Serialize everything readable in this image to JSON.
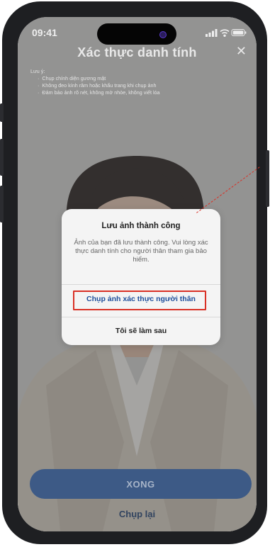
{
  "status_bar": {
    "time": "09:41"
  },
  "header": {
    "title": "Xác thực danh tính",
    "close_icon": "close-icon"
  },
  "notes": {
    "heading": "Lưu ý:",
    "items": [
      "Chụp chính diện gương mặt",
      "Không đeo kính râm hoặc khẩu trang khi chụp ảnh",
      "Đảm bảo ảnh rõ nét, không mờ nhòe, không viết lóa"
    ]
  },
  "dialog": {
    "title": "Lưu ảnh thành công",
    "message": "Ảnh của bạn đã lưu thành công. Vui lòng xác thực danh tính cho người thân tham gia bảo hiểm.",
    "primary_action": "Chụp ảnh xác thực người thân",
    "secondary_action": "Tôi sẽ làm sau"
  },
  "footer": {
    "done_label": "XONG",
    "retake_label": "Chụp lại"
  },
  "colors": {
    "primary_blue": "#1f4f9c",
    "highlight_red": "#d93025",
    "done_button": "#3d5a86"
  }
}
